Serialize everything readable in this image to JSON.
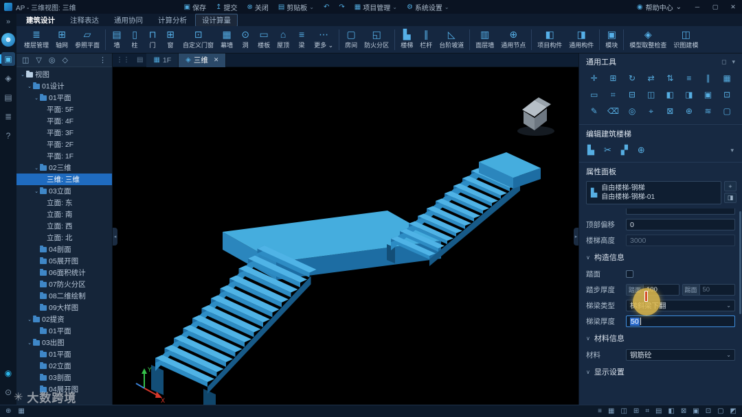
{
  "colors": {
    "accent": "#2a9fd8",
    "stair_blue": "#49b0e4",
    "selection": "#1f6bbf",
    "highlight_circle": "#e0bb4c",
    "viewport_bg": "#000000"
  },
  "titlebar": {
    "title": "AP - 三维视图: 三维",
    "menus": [
      {
        "id": "save",
        "label": "保存",
        "icon": "▣"
      },
      {
        "id": "submit",
        "label": "提交",
        "icon": "↥"
      },
      {
        "id": "close-doc",
        "label": "关闭",
        "icon": "⊗"
      },
      {
        "id": "clipboard",
        "label": "剪贴板",
        "icon": "▤",
        "caret": true
      },
      {
        "id": "undo",
        "label": "",
        "icon": "↶"
      },
      {
        "id": "redo",
        "label": "",
        "icon": "↷"
      },
      {
        "id": "project-mgmt",
        "label": "项目管理",
        "icon": "▦",
        "caret": true
      },
      {
        "id": "system-settings",
        "label": "系统设置",
        "icon": "⚙",
        "caret": true
      }
    ],
    "help": "帮助中心",
    "window_buttons": {
      "minimize": "─",
      "maximize": "▢",
      "close": "✕"
    }
  },
  "ribbon": {
    "tabs": [
      {
        "label": "建筑设计",
        "active": true
      },
      {
        "label": "注释表达"
      },
      {
        "label": "通用协同"
      },
      {
        "label": "计算分析"
      },
      {
        "label": "设计算量",
        "boxed": true
      }
    ],
    "buttons": [
      {
        "label": "楼层管理",
        "icon": "≣"
      },
      {
        "label": "轴网",
        "icon": "⊞"
      },
      {
        "label": "参照平面",
        "icon": "▱"
      },
      {
        "sep": true
      },
      {
        "label": "墙",
        "icon": "▤"
      },
      {
        "label": "柱",
        "icon": "▯"
      },
      {
        "label": "门",
        "icon": "⊓"
      },
      {
        "label": "窗",
        "icon": "⊞"
      },
      {
        "label": "自定义门窗",
        "icon": "⊡"
      },
      {
        "label": "幕墙",
        "icon": "▦"
      },
      {
        "label": "洞",
        "icon": "⊙"
      },
      {
        "label": "楼板",
        "icon": "▭"
      },
      {
        "label": "屋顶",
        "icon": "⌂"
      },
      {
        "label": "梁",
        "icon": "≡"
      },
      {
        "label": "更多",
        "icon": "⋯",
        "caret": true
      },
      {
        "sep": true
      },
      {
        "label": "房间",
        "icon": "▢"
      },
      {
        "label": "防火分区",
        "icon": "◱"
      },
      {
        "sep": true
      },
      {
        "label": "楼梯",
        "icon": "▙"
      },
      {
        "label": "栏杆",
        "icon": "∥"
      },
      {
        "label": "台阶坡道",
        "icon": "◺"
      },
      {
        "sep": true
      },
      {
        "label": "面层墙",
        "icon": "▥"
      },
      {
        "label": "通用节点",
        "icon": "⊕"
      },
      {
        "sep": true
      },
      {
        "label": "项目构件",
        "icon": "◧"
      },
      {
        "label": "通用构件",
        "icon": "◨"
      },
      {
        "sep": true
      },
      {
        "label": "模块",
        "icon": "▣"
      },
      {
        "sep": true
      },
      {
        "label": "模型取整检查",
        "icon": "◈"
      },
      {
        "label": "识图建模",
        "icon": "◫"
      }
    ]
  },
  "leftstrip": {
    "collapse": "»",
    "top": [
      {
        "name": "user-avatar",
        "icon": "☻",
        "style": "avatar"
      },
      {
        "name": "module-design",
        "icon": "▣",
        "active": true
      },
      {
        "name": "nav-compass",
        "icon": "◈"
      },
      {
        "name": "nav-docs",
        "icon": "▤"
      },
      {
        "name": "nav-list",
        "icon": "≣"
      },
      {
        "name": "help",
        "icon": "?"
      }
    ],
    "bottom": [
      {
        "name": "record",
        "icon": "◉"
      },
      {
        "name": "zoom-tool",
        "icon": "⊙"
      }
    ]
  },
  "tree": {
    "toolbar": [
      {
        "name": "view-mode",
        "icon": "◫"
      },
      {
        "name": "filter",
        "icon": "▽"
      },
      {
        "name": "locate",
        "icon": "◎"
      },
      {
        "name": "settings",
        "icon": "◇"
      }
    ],
    "toolbar_more": "⋮",
    "items": [
      {
        "level": 0,
        "label": "视图",
        "exp": true,
        "root": true
      },
      {
        "level": 1,
        "label": "01设计",
        "exp": true
      },
      {
        "level": 2,
        "label": "01平面",
        "exp": true
      },
      {
        "level": 3,
        "label": "平面: 5F"
      },
      {
        "level": 3,
        "label": "平面: 4F"
      },
      {
        "level": 3,
        "label": "平面: 3F"
      },
      {
        "level": 3,
        "label": "平面: 2F"
      },
      {
        "level": 3,
        "label": "平面: 1F"
      },
      {
        "level": 2,
        "label": "02三维",
        "exp": true
      },
      {
        "level": 3,
        "label": "三维: 三维",
        "sel": true
      },
      {
        "level": 2,
        "label": "03立面",
        "exp": true
      },
      {
        "level": 3,
        "label": "立面: 东"
      },
      {
        "level": 3,
        "label": "立面: 南"
      },
      {
        "level": 3,
        "label": "立面: 西"
      },
      {
        "level": 3,
        "label": "立面: 北"
      },
      {
        "level": 2,
        "label": "04剖面",
        "folder": true
      },
      {
        "level": 2,
        "label": "05展开图",
        "folder": true
      },
      {
        "level": 2,
        "label": "06面积统计",
        "folder": true
      },
      {
        "level": 2,
        "label": "07防火分区",
        "folder": true
      },
      {
        "level": 2,
        "label": "08二维绘制",
        "folder": true
      },
      {
        "level": 2,
        "label": "09大样图",
        "folder": true
      },
      {
        "level": 1,
        "label": "02提资",
        "exp": true
      },
      {
        "level": 2,
        "label": "01平面",
        "folder": true
      },
      {
        "level": 1,
        "label": "03出图",
        "exp": true
      },
      {
        "level": 2,
        "label": "01平面",
        "folder": true
      },
      {
        "level": 2,
        "label": "02立面",
        "folder": true
      },
      {
        "level": 2,
        "label": "03剖面",
        "folder": true
      },
      {
        "level": 2,
        "label": "04展开图",
        "folder": true
      }
    ]
  },
  "viewport": {
    "tabbar_icons": [
      {
        "name": "drag-handle",
        "icon": "⋮⋮"
      },
      {
        "name": "views",
        "icon": "▤"
      }
    ],
    "tabs": [
      {
        "label": "1F",
        "icon": "▦"
      },
      {
        "label": "三维",
        "icon": "◈",
        "active": true,
        "closable": true
      }
    ],
    "axis": {
      "x": "X",
      "y": "Y"
    }
  },
  "tools_panel": {
    "title": "通用工具",
    "header_icons": [
      "◻",
      "▾"
    ],
    "grid": [
      "✛",
      "⊞",
      "↻",
      "⇄",
      "⇅",
      "≡",
      "∥",
      "▦",
      "▭",
      "⌗",
      "⊟",
      "◫",
      "◧",
      "◨",
      "▣",
      "⊡",
      "✎",
      "⌫",
      "◎",
      "⌖",
      "⊠",
      "⊕",
      "≋",
      "▢"
    ]
  },
  "stair_edit": {
    "title": "编辑建筑楼梯",
    "icons": [
      "▙",
      "✂",
      "▞",
      "⊕"
    ],
    "caret": "▾"
  },
  "properties": {
    "title": "属性面板",
    "type_selector": {
      "line1": "自由楼梯-钢梯",
      "line2": "自由楼梯-钢梯-01",
      "icon": "▙",
      "add_button": "+",
      "more_button": "◨"
    },
    "rows": [
      {
        "type": "partial"
      },
      {
        "type": "field",
        "label": "顶部偏移",
        "control": "input",
        "value": "0"
      },
      {
        "type": "field",
        "label": "楼梯高度",
        "control": "input",
        "value": "3000",
        "disabled": true
      },
      {
        "type": "section",
        "label": "构造信息"
      },
      {
        "type": "field",
        "label": "踏面",
        "control": "checkbox",
        "checked": false
      },
      {
        "type": "field",
        "label": "踏步厚度",
        "control": "dual",
        "a_label": "踏面",
        "a_value": "100",
        "b_label": "踢面",
        "b_value": "50"
      },
      {
        "type": "field",
        "label": "梯梁类型",
        "control": "select",
        "value": "梯斜梁下翻"
      },
      {
        "type": "field",
        "label": "梯梁厚度",
        "control": "input",
        "value": "50",
        "selected": true
      },
      {
        "type": "section",
        "label": "材料信息"
      },
      {
        "type": "field",
        "label": "材料",
        "control": "select",
        "value": "钢筋砼"
      },
      {
        "type": "section",
        "label": "显示设置"
      }
    ]
  },
  "statusbar": {
    "left": [
      "⊕",
      "▦"
    ],
    "right": [
      "≡",
      "▦",
      "◫",
      "⊞",
      "⌗",
      "▤",
      "◧",
      "⊠",
      "▣",
      "⊡",
      "▢",
      "◩"
    ]
  },
  "watermark": {
    "logo": "✳",
    "text": "大数跨境"
  }
}
